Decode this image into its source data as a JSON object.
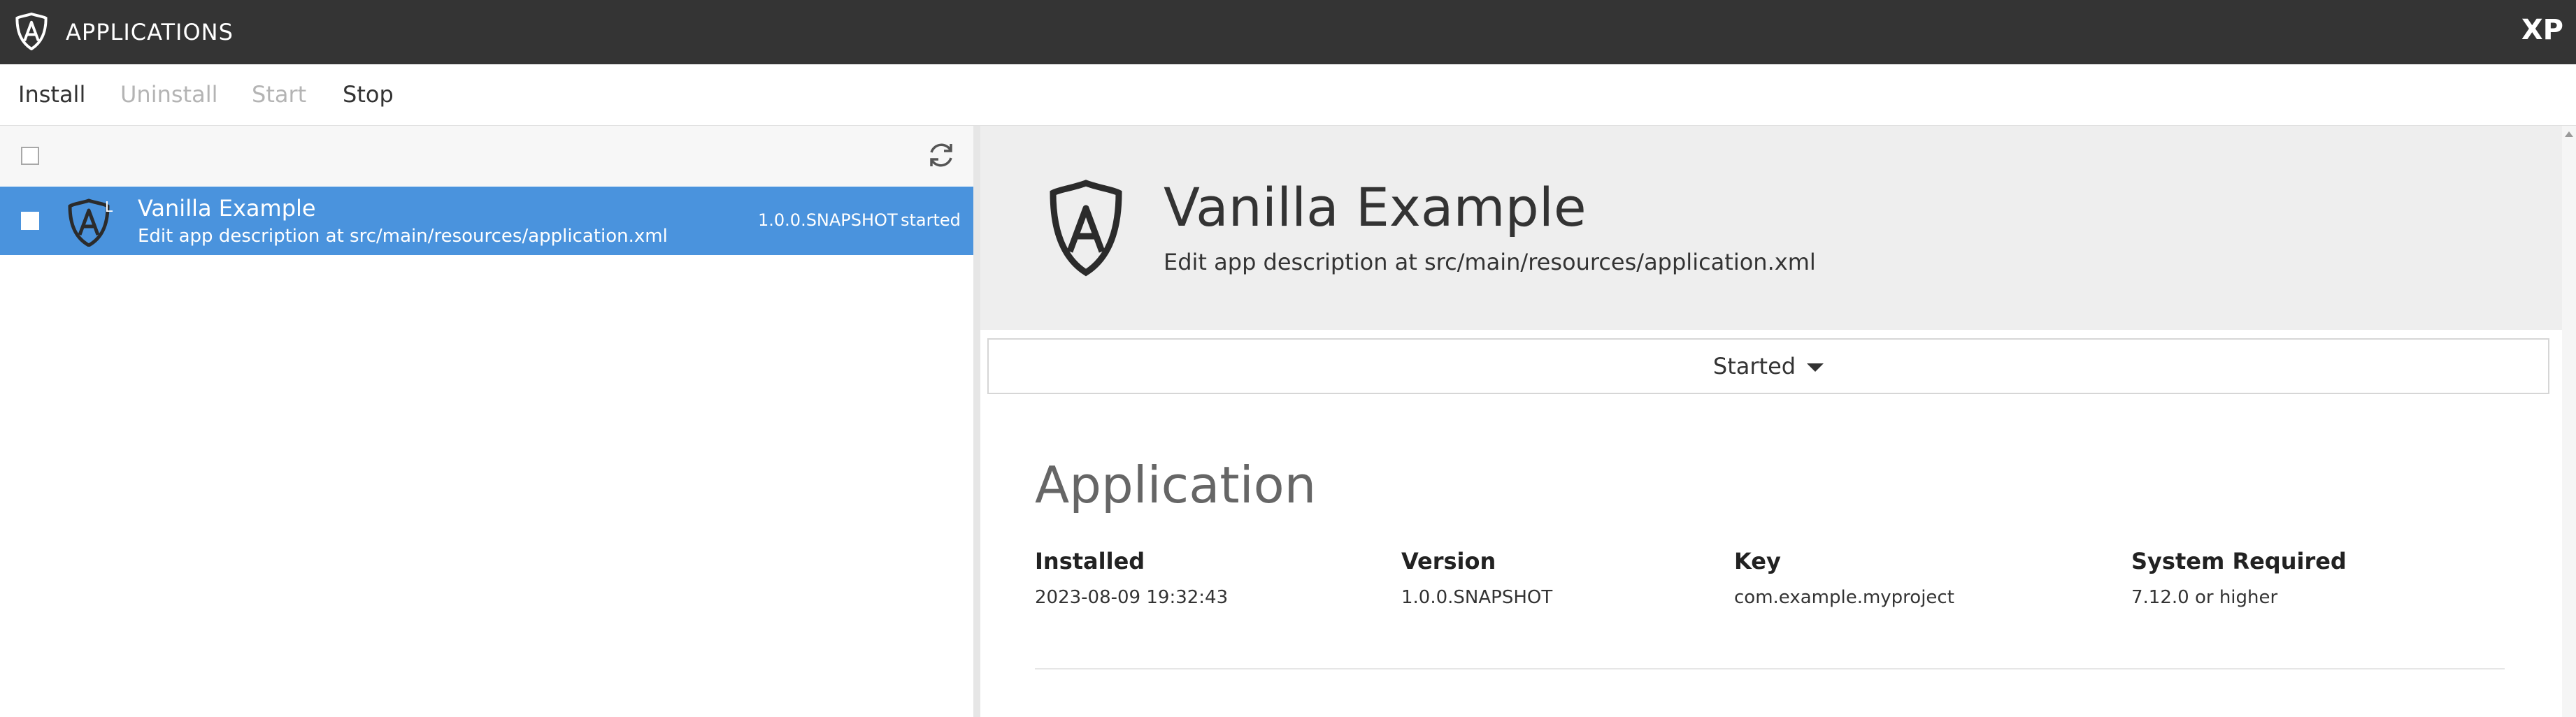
{
  "header": {
    "title": "APPLICATIONS",
    "brand": "XP",
    "logo_icon": "enonic-shield-icon"
  },
  "toolbar": {
    "install": "Install",
    "uninstall": "Uninstall",
    "start": "Start",
    "stop": "Stop"
  },
  "list": {
    "refresh_icon": "refresh-icon",
    "rows": [
      {
        "badge": "L",
        "title": "Vanilla Example",
        "description": "Edit app description at src/main/resources/application.xml",
        "version": "1.0.0.SNAPSHOT",
        "status": "started"
      }
    ]
  },
  "detail": {
    "title": "Vanilla Example",
    "description": "Edit app description at src/main/resources/application.xml",
    "status_dropdown": "Started",
    "section_title": "Application",
    "fields": [
      {
        "label": "Installed",
        "value": "2023-08-09 19:32:43"
      },
      {
        "label": "Version",
        "value": "1.0.0.SNAPSHOT"
      },
      {
        "label": "Key",
        "value": "com.example.myproject"
      },
      {
        "label": "System Required",
        "value": "7.12.0 or higher"
      }
    ]
  },
  "colors": {
    "header_bg": "#343434",
    "selection": "#4a93dd",
    "detail_header_bg": "#eeeeee"
  }
}
